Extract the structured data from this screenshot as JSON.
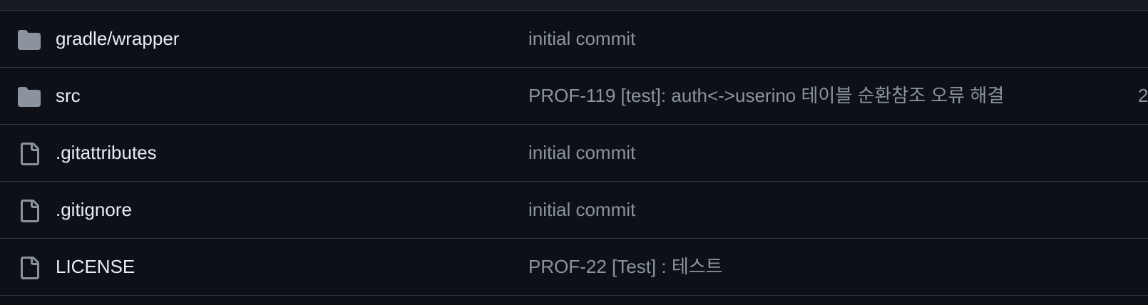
{
  "files": [
    {
      "type": "folder",
      "icon": "folder-icon",
      "name": "gradle/wrapper",
      "commit": "initial commit",
      "age": ""
    },
    {
      "type": "folder",
      "icon": "folder-icon",
      "name": "src",
      "commit": "PROF-119 [test]: auth<->userino 테이블 순환참조 오류 해결",
      "age": "2"
    },
    {
      "type": "file",
      "icon": "file-icon",
      "name": ".gitattributes",
      "commit": "initial commit",
      "age": ""
    },
    {
      "type": "file",
      "icon": "file-icon",
      "name": ".gitignore",
      "commit": "initial commit",
      "age": ""
    },
    {
      "type": "file",
      "icon": "file-icon",
      "name": "LICENSE",
      "commit": "PROF-22 [Test] : 테스트",
      "age": ""
    }
  ],
  "colors": {
    "background": "#0d1117",
    "border": "#30363d",
    "folder": "#8b949e",
    "text": "#e6edf3",
    "muted": "#8b949e"
  }
}
